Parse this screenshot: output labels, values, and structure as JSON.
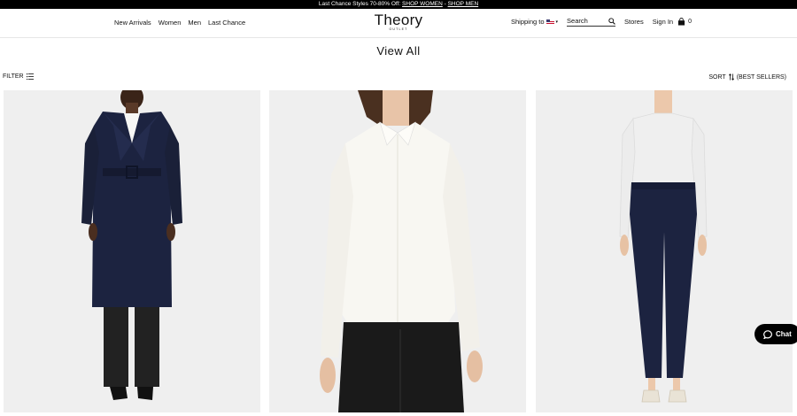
{
  "promo": {
    "text": "Last Chance Styles 70-80% Off: ",
    "link_women": "SHOP WOMEN",
    "separator": " - ",
    "link_men": "SHOP MEN"
  },
  "nav": {
    "items": [
      "New Arrivals",
      "Women",
      "Men",
      "Last Chance"
    ]
  },
  "logo": {
    "main": "Theory",
    "sub": "OUTLET"
  },
  "header_right": {
    "shipping": "Shipping to",
    "search_placeholder": "Search",
    "stores": "Stores",
    "sign_in": "Sign In",
    "bag_count": "0"
  },
  "page": {
    "title": "View All",
    "filter": "FILTER",
    "sort": "SORT",
    "sort_value": "(BEST SELLERS)"
  },
  "products": [
    {
      "icon": "product-trench-coat-image"
    },
    {
      "icon": "product-silk-blouse-image"
    },
    {
      "icon": "product-tailored-pants-image"
    }
  ],
  "chat": {
    "label": "Chat"
  },
  "colors": {
    "promo_bg": "#000000",
    "tile_bg": "#efefef",
    "navy": "#1c2340"
  }
}
